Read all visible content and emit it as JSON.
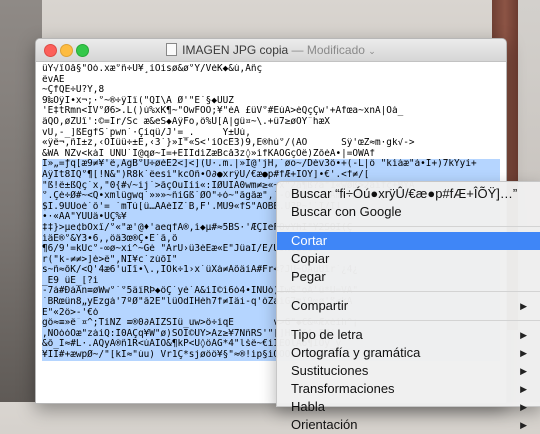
{
  "window": {
    "filename": "IMAGEN JPG copia",
    "separator": "—",
    "status": "Modificado",
    "chevron": "⌄"
  },
  "content_lines": [
    {
      "text": "üY√îÒå§\"Ôò.xæ°ñ÷Û¥¸íOísø&ø°Ÿ/VèK◆&ù,Åñç",
      "selected": false
    },
    {
      "text": "êvÅË",
      "selected": false
    },
    {
      "text": "~ÇfQË÷Ü?Y,8",
      "selected": false
    },
    {
      "text": "9‰ÔÿÎ•x¬;·°~®÷ÿÎï(\"QÌ\\Å Ø'\"Ë´§◆ÙÚZ",
      "selected": false
    },
    {
      "text": "'É‡tRmn<ÌV°Ø6>.L()ú%xK¶~\"ÕwFÕÕ;¥\"éÂ £üV°#ËúÂ>èQçÇw'+Afœa~xnÂ|Ôà_",
      "selected": false
    },
    {
      "text": "âQÕ,øZÛî':©=Ìr/Sc æ&eS◆ÁÿFo,ö%Ü[Â|gü¤~\\.+ü7≥øÔY¨hæX",
      "selected": false
    },
    {
      "text": "vÜ,-_]ßÊgfS`pwn`·Çíqû/J'=_.     Ÿ±Ûù,",
      "selected": false
    },
    {
      "text": "«ÿê¬,ñÎ±z,‹ÓÏüû÷±È,‹3`}»Ì\"«S<'íÕcË3)9,Ê®hú°/(ÅÖ      Sÿ'œZ≈m·gk√->",
      "selected": false
    },
    {
      "text": "&WÄ NZv<kàÎ ÙÑÜ`Ï@qø~Î=+ËÏÎdìZæBcå3z◊»ìfKÀÔGçÒê)ZõéÁ•|=ÓWÀf",
      "selected": false
    },
    {
      "text": "Ì»„=ƒq[æ9≠¥'ê,ÃgB°Û÷øèÉ2<]<](U·.m.|»Ì@'jH,`øo~/Dév3ö•+(-L|ö \"kìáæ\"á•Î+)7kYyí+",
      "selected": true
    },
    {
      "text": "ÄÿÏt8ÍQ°¶[!N&\")R8k`ëesì\"kcÓñ•Ó∂●xrÿÛ/€æ●p#fÆ+ÎÕŸ]•€'.<f≠/[",
      "selected": true
    },
    {
      "text": "\"ß!ë±ßQç`x,\"0{#√~ij`>ãçÓuÍíí«:ÎØÙÏÀ0wm≠≥«~x\"2a¶ß?ã\"1«wøß>2àífç+BYA",
      "selected": true
    },
    {
      "text": "°.Çé÷Ø#~<Q•xmlûgwq`»»»~ñíGß`ØÖ\"÷ó~\"ãgãæ\",`-ÓÉoNé‹ÌßAm≠÷Lß´}≠µ,",
      "selected": true
    },
    {
      "text": "$Î.9UUoè`õ'= `mTú[ü…ÅÀéÎZ`B,F'.MÛ9«fS\"ÂÖBË.Ü?P~'`Ì/Î|",
      "selected": true
    },
    {
      "text": "•·«ÅÀ\"ŸÜÛâ•ÜÇ%¥",
      "selected": true
    },
    {
      "text": "‡‡}>µe¢bÖxî/°«\"æ'@♦'aeqfÀ®,ì◆µ#≈5BS·'ÆÇÎeFÖvYhÏ\"Ÿ2SÕÏ(Ç",
      "selected": true
    },
    {
      "text": "ìâÊ®°&Ÿ3•6,,ôâ3œ®Ç•Ë`ã,õ",
      "selected": true
    },
    {
      "text": "¶6/9'=kÜc°-∞ø~xí^~Gé \"ÀrÜ›ü3éÊæ«Ë\"JûaÏ/Ë/ÚøNôÍä8Ë",
      "selected": true
    },
    {
      "text": "r(\"k-≠≠>]è>ë\",ÑÍ¥c`zúõÏ\"",
      "selected": true
    },
    {
      "text": "s~ñ≈õK/<Q'4æ6'uÏî•\\.,ÎÖk÷1›x`üXà≠ÀõâíÀ#Fr<?JÙ~ÓÃúÚîr`¿4¿",
      "selected": true
    },
    {
      "text": "_Ê9 üË_[?ì",
      "selected": true
    },
    {
      "text": "-7à#ÐàÀn≡øWw°`°5äïRÞ◆ôÇ`yé`À&ìÏ©ì6ò4•ÏÑÙò)ÎwS\"oÁ'ü*Û=VÄ\"",
      "selected": true
    },
    {
      "text": "´BRœûn8„yËzgá'7ºØ\"ã2Ë\"lüÕdÌHèh7f≠Ìâi-q'óZaìG7mî9∞ø'ß<kÁ",
      "selected": true
    },
    {
      "text": "Ë\"«2ö>-'€ò",
      "selected": true
    },
    {
      "text": "gö≈≡»ë¯¤^;TíNZ ≡®0∂ÃÍZSÌû_uw>ô÷iqË       v>G\"◆€&«Æxèìh^¡",
      "selected": true
    },
    {
      "text": ",ÑOòóÖæ\"záíQ:Ì0ÂÇq¥W\"ø)SÒÏ©ÛŸ>Áz≥¥7NñRŠ'\"[]Hò\"ñA,5ß´",
      "selected": true
    },
    {
      "text": "&õ_Ï≈#L·.ÃQyÃ®ñ1R<úÂÌÒ&¶kP<Û◊öÃG*4\"lšë~€iÏEÖlÁ6¶ÌÔÿ_ÿ",
      "selected": true
    },
    {
      "text": "¥ÌÌ#+æwpØ~/\"[kI≈\"ùu) Vr1Ç*sjøöö¥§\"≈®!ìp§ìQÓÖÍâó#ÑÒÅ7W",
      "selected": true
    }
  ],
  "menu": {
    "items": [
      {
        "label": "Buscar “ﬁ÷Óú●xrÿÛ/€æ●p#fÆ+ÎÕŸ]…”",
        "highlighted": false,
        "submenu": false
      },
      {
        "label": "Buscar con Google",
        "highlighted": false,
        "submenu": false
      },
      {
        "separator": true
      },
      {
        "label": "Cortar",
        "highlighted": true,
        "submenu": false
      },
      {
        "label": "Copiar",
        "highlighted": false,
        "submenu": false
      },
      {
        "label": "Pegar",
        "highlighted": false,
        "submenu": false
      },
      {
        "separator": true
      },
      {
        "label": "Compartir",
        "highlighted": false,
        "submenu": true
      },
      {
        "separator": true
      },
      {
        "label": "Tipo de letra",
        "highlighted": false,
        "submenu": true
      },
      {
        "label": "Ortografía y gramática",
        "highlighted": false,
        "submenu": true
      },
      {
        "label": "Sustituciones",
        "highlighted": false,
        "submenu": true
      },
      {
        "label": "Transformaciones",
        "highlighted": false,
        "submenu": true
      },
      {
        "label": "Habla",
        "highlighted": false,
        "submenu": true
      },
      {
        "label": "Orientación",
        "highlighted": false,
        "submenu": true
      }
    ],
    "submenu_arrow": "▶"
  },
  "colors": {
    "selection": "#b5d5ff",
    "highlight": "#3f86f7"
  }
}
